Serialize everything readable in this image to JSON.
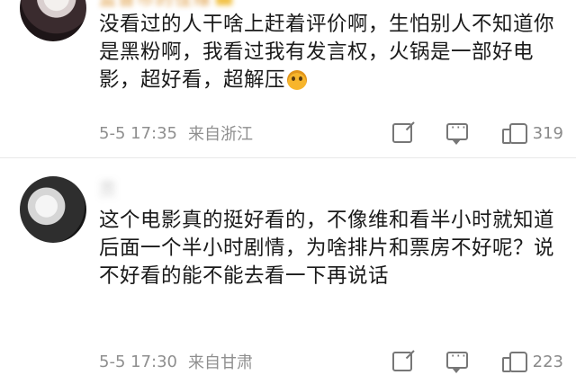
{
  "comments": [
    {
      "username": "监督市的佳缘",
      "text": "没看过的人干啥上赶着评价啊，生怕别人不知道你是黑粉啊，我看过我有发言权，火锅是一部好电影，超好看，超解压",
      "emoji": "smile-emoji",
      "time": "5-5 17:35",
      "location": "来自浙江",
      "likes": "319"
    },
    {
      "username": "页",
      "text": "这个电影真的挺好看的，不像维和看半小时就知道后面一个半小时剧情，为啥排片和票房不好呢？说不好看的能不能去看一下再说话",
      "time": "5-5 17:30",
      "location": "来自甘肃",
      "likes": "223"
    }
  ],
  "icons": {
    "share": "share-icon",
    "comment": "comment-icon",
    "like": "like-icon"
  },
  "colors": {
    "text": "#1a1a1a",
    "meta": "#8f8f8f",
    "username_vip": "#d98a1e",
    "divider": "#e8e8e8"
  }
}
